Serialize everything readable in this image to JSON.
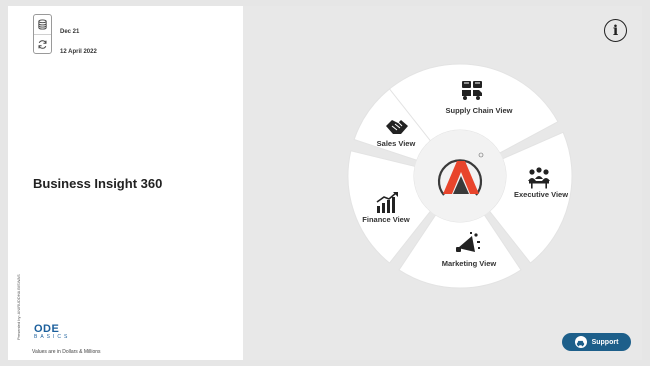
{
  "header": {
    "data_period": "Dec 21",
    "refresh_date": "12 April 2022"
  },
  "title": "Business Insight 360",
  "credit": "Presented by: ANIRUDDHA BISWAS",
  "brand": {
    "name": "ODE",
    "tagline": "BASICS"
  },
  "footnote": "Values are in Dollars & Millions",
  "nav": {
    "supply_chain": "Supply Chain View",
    "sales": "Sales View",
    "executive": "Executive View",
    "finance": "Finance View",
    "marketing": "Marketing View"
  },
  "info_glyph": "i",
  "support_label": "Support",
  "colors": {
    "accent": "#1d5f8a",
    "logo_red": "#e8452c",
    "logo_dark": "#3a3a3a",
    "brand_blue": "#1b5f9c"
  },
  "icons": {
    "period": "database-icon",
    "refresh": "refresh-icon",
    "supply_chain": "supply-chain-icon",
    "sales": "handshake-icon",
    "executive": "executive-team-icon",
    "finance": "growth-chart-icon",
    "marketing": "megaphone-icon",
    "support": "car-icon",
    "info": "info-icon"
  }
}
